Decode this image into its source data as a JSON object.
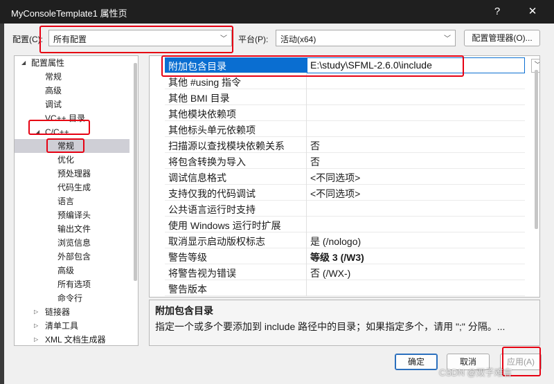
{
  "window": {
    "title": "MyConsoleTemplate1 属性页",
    "help_label": "?",
    "close_label": "✕"
  },
  "top": {
    "config_label": "配置(C):",
    "config_value": "所有配置",
    "platform_label": "平台(P):",
    "platform_value": "活动(x64)",
    "config_manager_label": "配置管理器(O)..."
  },
  "tree": {
    "items": [
      {
        "label": "配置属性",
        "arrow": "◢"
      },
      {
        "label": "常规"
      },
      {
        "label": "高级"
      },
      {
        "label": "调试"
      },
      {
        "label": "VC++ 目录"
      },
      {
        "label": "C/C++",
        "arrow": "◢"
      },
      {
        "label": "常规"
      },
      {
        "label": "优化"
      },
      {
        "label": "预处理器"
      },
      {
        "label": "代码生成"
      },
      {
        "label": "语言"
      },
      {
        "label": "预编译头"
      },
      {
        "label": "输出文件"
      },
      {
        "label": "浏览信息"
      },
      {
        "label": "外部包含"
      },
      {
        "label": "高级"
      },
      {
        "label": "所有选项"
      },
      {
        "label": "命令行"
      },
      {
        "label": "链接器",
        "arrow": "▷"
      },
      {
        "label": "清单工具",
        "arrow": "▷"
      },
      {
        "label": "XML 文档生成器",
        "arrow": "▷"
      }
    ]
  },
  "grid": {
    "rows": [
      {
        "name": "附加包含目录",
        "value": "E:\\study\\SFML-2.6.0\\include"
      },
      {
        "name": "其他 #using 指令",
        "value": ""
      },
      {
        "name": "其他 BMI 目录",
        "value": ""
      },
      {
        "name": "其他模块依赖项",
        "value": ""
      },
      {
        "name": "其他标头单元依赖项",
        "value": ""
      },
      {
        "name": "扫描源以查找模块依赖关系",
        "value": "否"
      },
      {
        "name": "将包含转换为导入",
        "value": "否"
      },
      {
        "name": "调试信息格式",
        "value": "<不同选项>"
      },
      {
        "name": "支持仅我的代码调试",
        "value": "<不同选项>"
      },
      {
        "name": "公共语言运行时支持",
        "value": ""
      },
      {
        "name": "使用 Windows 运行时扩展",
        "value": ""
      },
      {
        "name": "取消显示启动版权标志",
        "value": "是 (/nologo)"
      },
      {
        "name": "警告等级",
        "value": "等级 3 (/W3)"
      },
      {
        "name": "将警告视为错误",
        "value": "否 (/WX-)"
      },
      {
        "name": "警告版本",
        "value": ""
      }
    ]
  },
  "description": {
    "title": "附加包含目录",
    "text": "指定一个或多个要添加到 include 路径中的目录；如果指定多个，请用 \";\" 分隔。..."
  },
  "buttons": {
    "ok": "确定",
    "cancel": "取消",
    "apply": "应用(A)"
  },
  "watermark": "CSDN @双子难言",
  "colors": {
    "selection": "#0a6ed1",
    "highlight": "#e60012"
  }
}
